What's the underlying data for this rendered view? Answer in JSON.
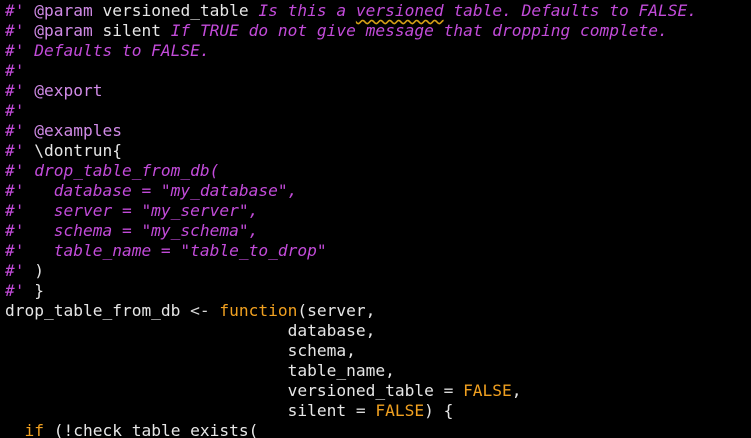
{
  "editor": {
    "lines": [
      {
        "segments": [
          {
            "t": "#'",
            "c": "pfx"
          },
          {
            "t": " ",
            "c": "pl"
          },
          {
            "t": "@param",
            "c": "tag"
          },
          {
            "t": " versioned_table ",
            "c": "arg"
          },
          {
            "t": "Is this a ",
            "c": "cm"
          },
          {
            "t": "versioned",
            "c": "cm sq"
          },
          {
            "t": " table. Defaults to FALSE.",
            "c": "cm"
          }
        ]
      },
      {
        "segments": [
          {
            "t": "#'",
            "c": "pfx"
          },
          {
            "t": " ",
            "c": "pl"
          },
          {
            "t": "@param",
            "c": "tag"
          },
          {
            "t": " silent ",
            "c": "arg"
          },
          {
            "t": "If TRUE do not give message that dropping complete.",
            "c": "cm"
          }
        ]
      },
      {
        "segments": [
          {
            "t": "#' Defaults to FALSE.",
            "c": "cm"
          }
        ]
      },
      {
        "segments": [
          {
            "t": "#'",
            "c": "pfx"
          }
        ]
      },
      {
        "segments": [
          {
            "t": "#'",
            "c": "pfx"
          },
          {
            "t": " ",
            "c": "pl"
          },
          {
            "t": "@export",
            "c": "tag"
          }
        ]
      },
      {
        "segments": [
          {
            "t": "#'",
            "c": "pfx"
          }
        ]
      },
      {
        "segments": [
          {
            "t": "#'",
            "c": "pfx"
          },
          {
            "t": " ",
            "c": "pl"
          },
          {
            "t": "@examples",
            "c": "tag"
          }
        ]
      },
      {
        "segments": [
          {
            "t": "#'",
            "c": "pfx"
          },
          {
            "t": " \\dontrun{",
            "c": "arg"
          }
        ]
      },
      {
        "segments": [
          {
            "t": "#' drop_table_from_db(",
            "c": "cm"
          }
        ]
      },
      {
        "segments": [
          {
            "t": "#'   database = \"my_database\",",
            "c": "cm"
          }
        ]
      },
      {
        "segments": [
          {
            "t": "#'   server = \"my_server\",",
            "c": "cm"
          }
        ]
      },
      {
        "segments": [
          {
            "t": "#'   schema = \"my_schema\",",
            "c": "cm"
          }
        ]
      },
      {
        "segments": [
          {
            "t": "#'   table_name = \"table_to_drop\"",
            "c": "cm"
          }
        ]
      },
      {
        "segments": [
          {
            "t": "#'",
            "c": "pfx"
          },
          {
            "t": " )",
            "c": "arg"
          }
        ]
      },
      {
        "segments": [
          {
            "t": "#'",
            "c": "pfx"
          },
          {
            "t": " }",
            "c": "arg"
          }
        ]
      },
      {
        "segments": [
          {
            "t": "drop_table_from_db ",
            "c": "pl"
          },
          {
            "t": "<-",
            "c": "op"
          },
          {
            "t": " ",
            "c": "pl"
          },
          {
            "t": "function",
            "c": "kw"
          },
          {
            "t": "(server,",
            "c": "pl"
          }
        ]
      },
      {
        "segments": [
          {
            "t": "                             database,",
            "c": "pl"
          }
        ]
      },
      {
        "segments": [
          {
            "t": "                             schema,",
            "c": "pl"
          }
        ]
      },
      {
        "segments": [
          {
            "t": "                             table_name,",
            "c": "pl"
          }
        ]
      },
      {
        "segments": [
          {
            "t": "                             versioned_table ",
            "c": "pl"
          },
          {
            "t": "=",
            "c": "op"
          },
          {
            "t": " ",
            "c": "pl"
          },
          {
            "t": "FALSE",
            "c": "kw"
          },
          {
            "t": ",",
            "c": "pl"
          }
        ]
      },
      {
        "segments": [
          {
            "t": "                             silent ",
            "c": "pl"
          },
          {
            "t": "=",
            "c": "op"
          },
          {
            "t": " ",
            "c": "pl"
          },
          {
            "t": "FALSE",
            "c": "kw"
          },
          {
            "t": ") {",
            "c": "pl"
          }
        ]
      },
      {
        "segments": [
          {
            "t": "  ",
            "c": "pl"
          },
          {
            "t": "if",
            "c": "kw"
          },
          {
            "t": " (!check_table_exists(",
            "c": "pl"
          }
        ]
      }
    ]
  }
}
